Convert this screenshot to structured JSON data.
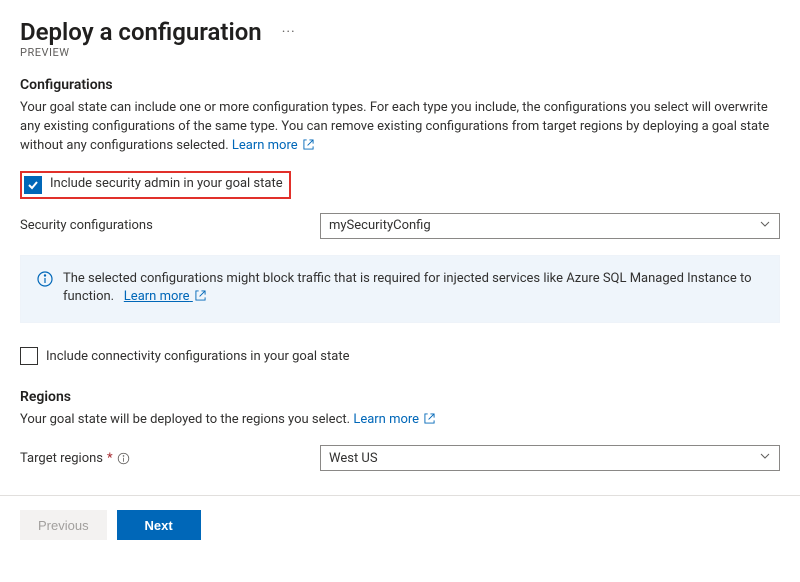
{
  "header": {
    "title": "Deploy a configuration",
    "badge": "PREVIEW",
    "ellipsis": "···"
  },
  "configurations": {
    "heading": "Configurations",
    "description": "Your goal state can include one or more configuration types. For each type you include, the configurations you select will overwrite any existing configurations of the same type. You can remove existing configurations from target regions by deploying a goal state without any configurations selected.",
    "learn_more": "Learn more",
    "include_security_label": "Include security admin in your goal state",
    "security_config_label": "Security configurations",
    "security_config_value": "mySecurityConfig",
    "banner_text": "The selected configurations might block traffic that is required for injected services like Azure SQL Managed Instance to function.",
    "banner_learn_more": "Learn more",
    "include_connectivity_label": "Include connectivity configurations in your goal state"
  },
  "regions": {
    "heading": "Regions",
    "description": "Your goal state will be deployed to the regions you select.",
    "learn_more": "Learn more",
    "target_label": "Target regions",
    "target_value": "West US"
  },
  "footer": {
    "previous": "Previous",
    "next": "Next"
  }
}
